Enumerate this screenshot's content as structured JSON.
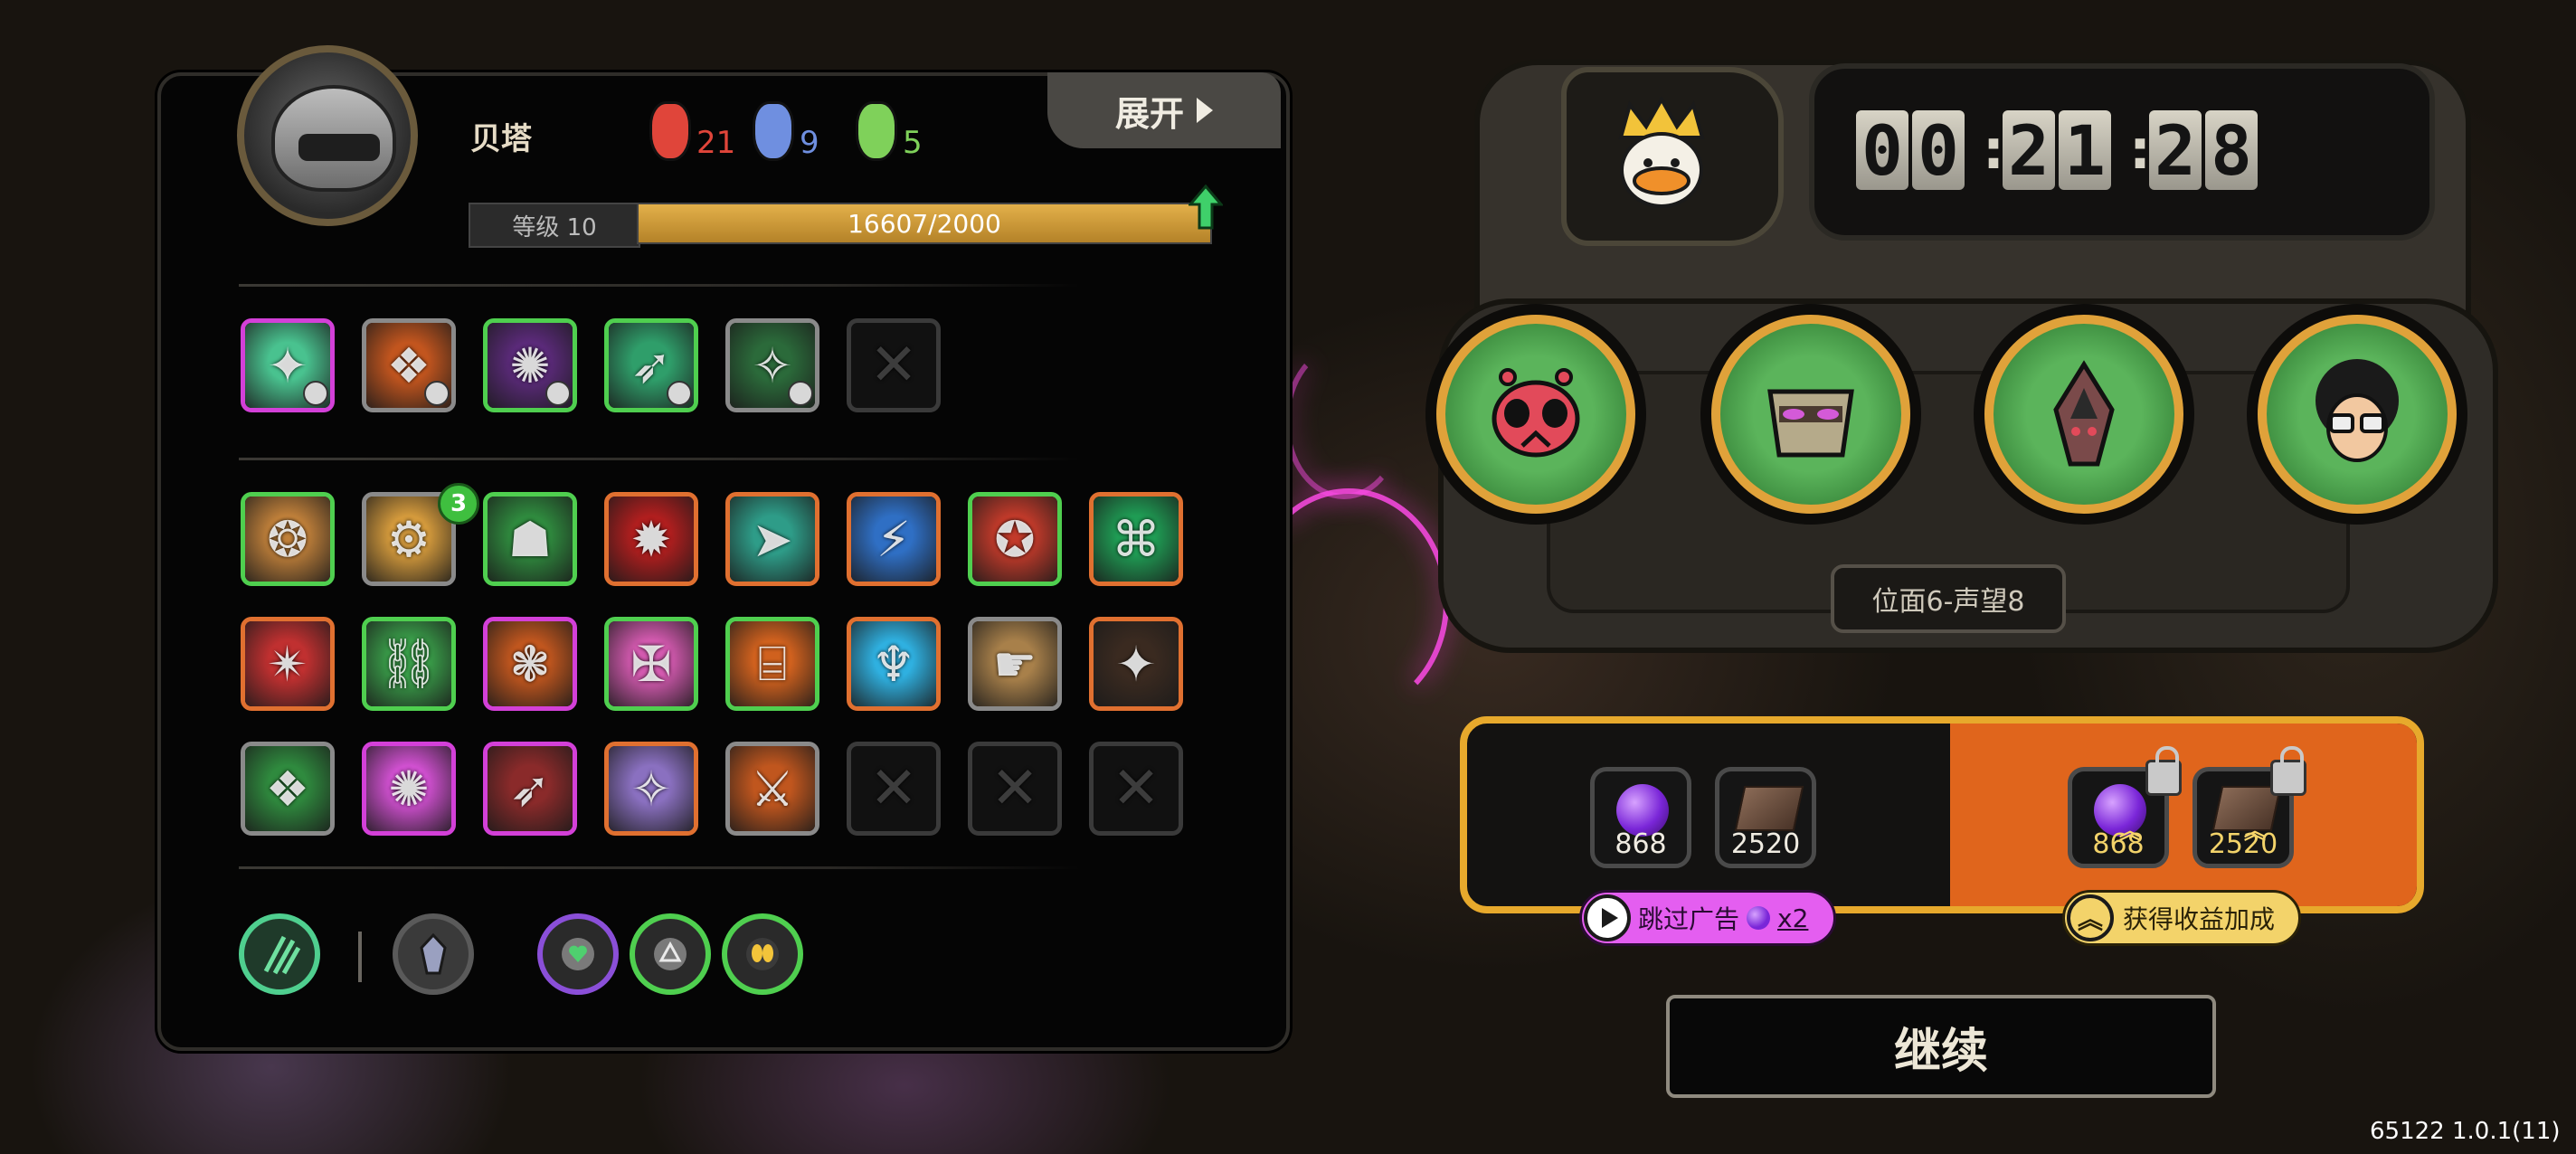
{
  "player": {
    "name": "贝塔",
    "stats": [
      {
        "icon": "red-mask-icon",
        "value": "21",
        "color": "#e0453a"
      },
      {
        "icon": "blue-mask-icon",
        "value": "9",
        "color": "#6f8fe0"
      },
      {
        "icon": "green-mask-icon",
        "value": "5",
        "color": "#7fd15a"
      }
    ],
    "level_label": "等级 10",
    "xp_text": "16607/2000",
    "xp_progress": 1.0
  },
  "expand_label": "展开",
  "skill_row": [
    {
      "icon": "crosshair-gear-icon",
      "border": "#d340d8",
      "bg": "#49c28f"
    },
    {
      "icon": "fire-demon-icon",
      "border": "#8a8a8a",
      "bg": "#c2551e"
    },
    {
      "icon": "purple-burst-icon",
      "border": "#4fcf4f",
      "bg": "#5b2a7a"
    },
    {
      "icon": "green-arrow-tree-icon",
      "border": "#4fcf4f",
      "bg": "#2f9e6a"
    },
    {
      "icon": "green-spike-icon",
      "border": "#8a8a8a",
      "bg": "#2b6a3a"
    },
    {
      "icon": "empty-slot-icon",
      "border": "#3a3a3a",
      "bg": "",
      "empty": true
    }
  ],
  "item_grid": [
    [
      {
        "icon": "earth-spikes-icon",
        "border": "#4fcf4f",
        "bg": "#c0803a"
      },
      {
        "icon": "sunrise-icon",
        "border": "#8a8a8a",
        "bg": "#d49a3c",
        "badge": "3"
      },
      {
        "icon": "green-flame-icon",
        "border": "#4fcf4f",
        "bg": "#2f8a3e"
      },
      {
        "icon": "red-jaw-icon",
        "border": "#e07030",
        "bg": "#b01e1e"
      },
      {
        "icon": "teal-spears-icon",
        "border": "#e07030",
        "bg": "#2e9c88"
      },
      {
        "icon": "blue-dagger-icon",
        "border": "#e07030",
        "bg": "#2f6fc4"
      },
      {
        "icon": "red-claw-icon",
        "border": "#4fcf4f",
        "bg": "#c23a2a"
      },
      {
        "icon": "green-swirl-icon",
        "border": "#e07030",
        "bg": "#1f9c54"
      }
    ],
    [
      {
        "icon": "crossed-blades-icon",
        "border": "#e07030",
        "bg": "#c03030"
      },
      {
        "icon": "red-arrow-icon",
        "border": "#4fcf4f",
        "bg": "#3aa04a"
      },
      {
        "icon": "lightning-arrows-icon",
        "border": "#d340d8",
        "bg": "#c0561e"
      },
      {
        "icon": "star-sigil-icon",
        "border": "#4fcf4f",
        "bg": "#d45ab0"
      },
      {
        "icon": "broken-pillar-icon",
        "border": "#4fcf4f",
        "bg": "#d0611e"
      },
      {
        "icon": "dark-shuriken-icon",
        "border": "#e07030",
        "bg": "#2fb0e0"
      },
      {
        "icon": "chain-links-icon",
        "border": "#8a8a8a",
        "bg": "#a8804a"
      },
      {
        "icon": "white-gear-icon",
        "border": "#e07030",
        "bg": "#3a2a20"
      }
    ],
    [
      {
        "icon": "green-wings-icon",
        "border": "#8a8a8a",
        "bg": "#2f8a3e"
      },
      {
        "icon": "pink-tome-icon",
        "border": "#d340d8",
        "bg": "#d050d0"
      },
      {
        "icon": "stone-pillar-icon",
        "border": "#d340d8",
        "bg": "#8a2a2a"
      },
      {
        "icon": "beast-roar-icon",
        "border": "#e07030",
        "bg": "#8a70c0"
      },
      {
        "icon": "pointing-hand-icon",
        "border": "#8a8a8a",
        "bg": "#c0561e"
      },
      {
        "icon": "empty-slot-icon",
        "border": "#3a3a3a",
        "bg": "",
        "empty": true
      },
      {
        "icon": "empty-slot-icon",
        "border": "#3a3a3a",
        "bg": "",
        "empty": true
      },
      {
        "icon": "empty-slot-icon",
        "border": "#3a3a3a",
        "bg": "",
        "empty": true
      }
    ]
  ],
  "bottom_icons": [
    {
      "icon": "claw-slash-icon",
      "border": "#4fcf8f"
    },
    {
      "icon": "mask-spirit-icon",
      "border": "#8a8a8a"
    },
    {
      "icon": "heart-shield-icon",
      "border": "#8a4fd8"
    },
    {
      "icon": "triangle-rune-icon",
      "border": "#4fcf4f"
    },
    {
      "icon": "twin-flame-icon",
      "border": "#4fcf4f"
    }
  ],
  "timer": {
    "h": "00",
    "m": "21",
    "s": "28"
  },
  "crown_icon": "crowned-duck-icon",
  "team": [
    {
      "name": "red-bug-hero-icon"
    },
    {
      "name": "robot-hero-icon"
    },
    {
      "name": "dark-bird-hero-icon"
    },
    {
      "name": "afro-glasses-hero-icon"
    }
  ],
  "stage_label": "位面6-声望8",
  "rewards": {
    "base": [
      {
        "icon": "purple-orb-icon",
        "value": "868"
      },
      {
        "icon": "leather-book-icon",
        "value": "2520"
      }
    ],
    "boosted": [
      {
        "icon": "purple-orb-icon",
        "value": "868"
      },
      {
        "icon": "leather-book-icon",
        "value": "2520"
      }
    ]
  },
  "skip_ad": {
    "label": "跳过广告",
    "multiplier": "x2"
  },
  "boost_label": "获得收益加成",
  "continue_label": "继续",
  "version": "65122 1.0.1(11)"
}
